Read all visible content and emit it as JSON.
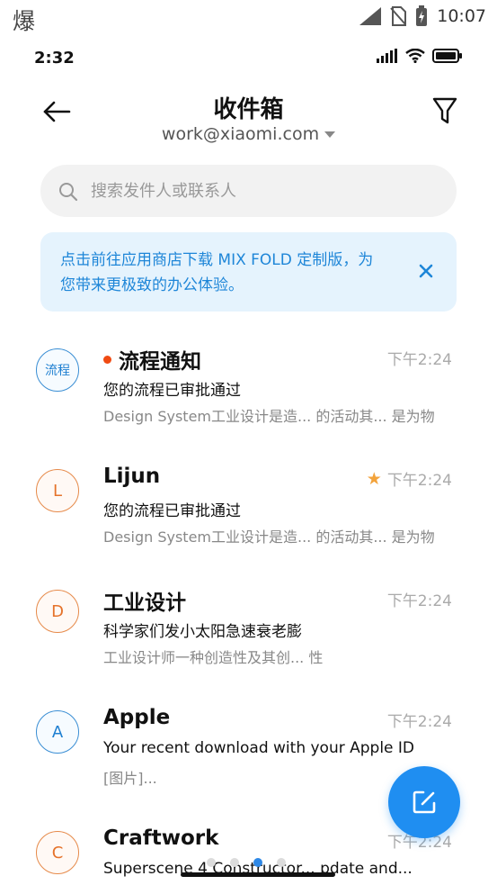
{
  "system_bar": {
    "left_char": "爆",
    "time": "10:07"
  },
  "inner_status": {
    "time": "2:32"
  },
  "header": {
    "title": "收件箱",
    "account": "work@xiaomi.com"
  },
  "search": {
    "placeholder": "搜索发件人或联系人"
  },
  "banner": {
    "text": "点击前往应用商店下载 MIX FOLD 定制版，为您带来更极致的办公体验。"
  },
  "mails": [
    {
      "avatar": "流程",
      "color": "blue",
      "sender": "流程通知",
      "unread": true,
      "starred": false,
      "time": "下午2:24",
      "subject": "您的流程已审批通过",
      "preview": "Design System工业设计是造... 的活动其... 是为物"
    },
    {
      "avatar": "L",
      "color": "orange",
      "sender": "Lijun",
      "unread": false,
      "starred": true,
      "time": "下午2:24",
      "subject": "您的流程已审批通过",
      "preview": "Design System工业设计是造... 的活动其... 是为物"
    },
    {
      "avatar": "D",
      "color": "orange",
      "sender": "工业设计",
      "unread": false,
      "starred": false,
      "time": "下午2:24",
      "subject": "科学家们发小太阳急速衰老膨",
      "preview": "工业设计师一种创造性及其创... 性"
    },
    {
      "avatar": "A",
      "color": "blue",
      "sender": "Apple",
      "unread": false,
      "starred": false,
      "time": "下午2:24",
      "subject": "Your recent download with  your Apple ID",
      "preview": "[图片]..."
    },
    {
      "avatar": "C",
      "color": "orange",
      "sender": "Craftwork",
      "unread": false,
      "starred": false,
      "time": "下午2:24",
      "subject": "Superscene 4 Constructor... pdate and...",
      "preview": ""
    }
  ],
  "colors": {
    "accent": "#1f8ef1",
    "banner_bg": "#e5f3fd",
    "unread_dot": "#f04a12",
    "star": "#f3a33b"
  },
  "icons": [
    "back-arrow-icon",
    "filter-icon",
    "search-icon",
    "close-icon",
    "compose-icon",
    "signal-icon",
    "wifi-icon",
    "battery-icon"
  ]
}
